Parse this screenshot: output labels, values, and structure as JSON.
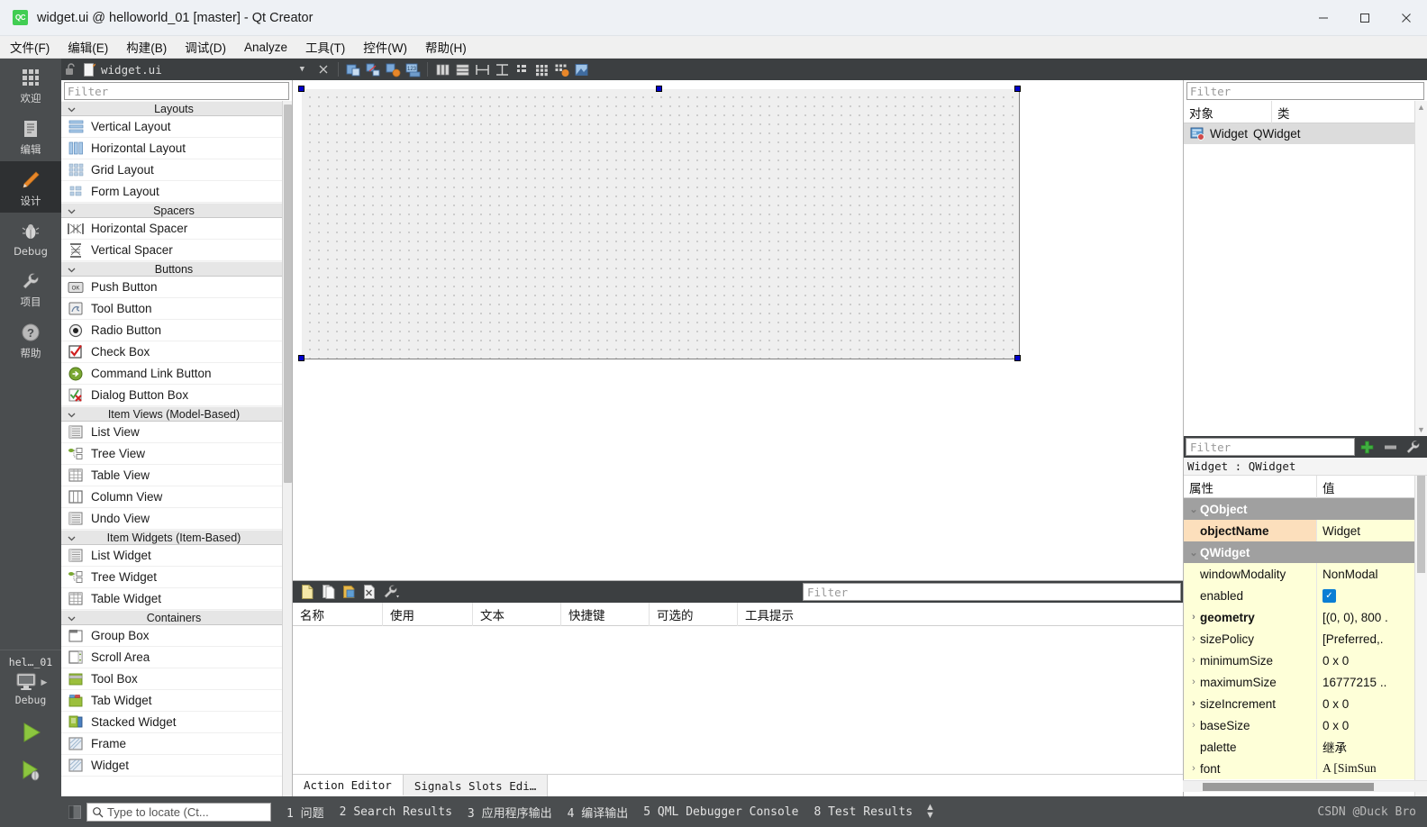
{
  "window": {
    "title": "widget.ui @ helloworld_01 [master] - Qt Creator",
    "logo_text": "QC",
    "controls": {
      "minimize": "minimize-icon",
      "maximize": "maximize-icon",
      "close": "close-icon"
    }
  },
  "menubar": {
    "items": [
      {
        "label": "文件(F)",
        "name": "menu-file"
      },
      {
        "label": "编辑(E)",
        "name": "menu-edit"
      },
      {
        "label": "构建(B)",
        "name": "menu-build"
      },
      {
        "label": "调试(D)",
        "name": "menu-debug"
      },
      {
        "label": "Analyze",
        "name": "menu-analyze"
      },
      {
        "label": "工具(T)",
        "name": "menu-tools"
      },
      {
        "label": "控件(W)",
        "name": "menu-window"
      },
      {
        "label": "帮助(H)",
        "name": "menu-help"
      }
    ]
  },
  "modebar": {
    "items": [
      {
        "label": "欢迎",
        "icon": "grid-icon",
        "active": false
      },
      {
        "label": "编辑",
        "icon": "document-icon",
        "active": false
      },
      {
        "label": "设计",
        "icon": "pencil-icon",
        "active": true
      },
      {
        "label": "Debug",
        "icon": "bug-icon",
        "active": false
      },
      {
        "label": "项目",
        "icon": "wrench-icon",
        "active": false
      },
      {
        "label": "帮助",
        "icon": "question-icon",
        "active": false
      }
    ],
    "kit": {
      "project": "hel…_01",
      "build_config": "Debug",
      "target_icon": "monitor-icon"
    },
    "actions": [
      {
        "name": "run-button",
        "icon": "play-icon"
      },
      {
        "name": "debug-button",
        "icon": "play-bug-icon"
      },
      {
        "name": "build-button",
        "icon": "hammer-icon"
      }
    ]
  },
  "editor_toolbar": {
    "lock_icon": "unlocked-icon",
    "file_icon": "ui-file-icon",
    "file_name": "widget.ui",
    "dropdown_icon": "chevron-down-icon",
    "close_icon": "close-icon",
    "buttons": [
      {
        "name": "edit-widgets-button",
        "icon": "edit-widgets-icon"
      },
      {
        "name": "edit-signals-slots-button",
        "icon": "signals-slots-icon"
      },
      {
        "name": "edit-buddies-button",
        "icon": "buddies-icon"
      },
      {
        "name": "edit-tab-order-button",
        "icon": "tab-order-icon"
      },
      {
        "name": "layout-horizontally-button",
        "icon": "layout-h-icon"
      },
      {
        "name": "layout-vertically-button",
        "icon": "layout-v-icon"
      },
      {
        "name": "layout-splitter-h-button",
        "icon": "splitter-h-icon"
      },
      {
        "name": "layout-splitter-v-button",
        "icon": "splitter-v-icon"
      },
      {
        "name": "layout-form-button",
        "icon": "form-layout-icon"
      },
      {
        "name": "layout-grid-button",
        "icon": "grid-layout-icon"
      },
      {
        "name": "break-layout-button",
        "icon": "break-layout-icon"
      },
      {
        "name": "adjust-size-button",
        "icon": "adjust-size-icon"
      }
    ]
  },
  "widget_box": {
    "filter_placeholder": "Filter",
    "groups": [
      {
        "title": "Layouts",
        "name": "widget-group-layouts",
        "items": [
          {
            "label": "Vertical Layout",
            "icon": "vertical-layout-icon"
          },
          {
            "label": "Horizontal Layout",
            "icon": "horizontal-layout-icon"
          },
          {
            "label": "Grid Layout",
            "icon": "grid-layout-icon"
          },
          {
            "label": "Form Layout",
            "icon": "form-layout-icon"
          }
        ]
      },
      {
        "title": "Spacers",
        "name": "widget-group-spacers",
        "items": [
          {
            "label": "Horizontal Spacer",
            "icon": "horizontal-spacer-icon"
          },
          {
            "label": "Vertical Spacer",
            "icon": "vertical-spacer-icon"
          }
        ]
      },
      {
        "title": "Buttons",
        "name": "widget-group-buttons",
        "items": [
          {
            "label": "Push Button",
            "icon": "push-button-icon"
          },
          {
            "label": "Tool Button",
            "icon": "tool-button-icon"
          },
          {
            "label": "Radio Button",
            "icon": "radio-button-icon"
          },
          {
            "label": "Check Box",
            "icon": "check-box-icon"
          },
          {
            "label": "Command Link Button",
            "icon": "command-link-icon"
          },
          {
            "label": "Dialog Button Box",
            "icon": "dialog-button-box-icon"
          }
        ]
      },
      {
        "title": "Item Views (Model-Based)",
        "name": "widget-group-item-views",
        "items": [
          {
            "label": "List View",
            "icon": "list-view-icon"
          },
          {
            "label": "Tree View",
            "icon": "tree-view-icon"
          },
          {
            "label": "Table View",
            "icon": "table-view-icon"
          },
          {
            "label": "Column View",
            "icon": "column-view-icon"
          },
          {
            "label": "Undo View",
            "icon": "undo-view-icon"
          }
        ]
      },
      {
        "title": "Item Widgets (Item-Based)",
        "name": "widget-group-item-widgets",
        "items": [
          {
            "label": "List Widget",
            "icon": "list-widget-icon"
          },
          {
            "label": "Tree Widget",
            "icon": "tree-widget-icon"
          },
          {
            "label": "Table Widget",
            "icon": "table-widget-icon"
          }
        ]
      },
      {
        "title": "Containers",
        "name": "widget-group-containers",
        "items": [
          {
            "label": "Group Box",
            "icon": "group-box-icon"
          },
          {
            "label": "Scroll Area",
            "icon": "scroll-area-icon"
          },
          {
            "label": "Tool Box",
            "icon": "tool-box-icon"
          },
          {
            "label": "Tab Widget",
            "icon": "tab-widget-icon"
          },
          {
            "label": "Stacked Widget",
            "icon": "stacked-widget-icon"
          },
          {
            "label": "Frame",
            "icon": "frame-icon"
          },
          {
            "label": "Widget",
            "icon": "widget-icon"
          }
        ]
      }
    ]
  },
  "form_canvas": {
    "selection_handles": 4,
    "widget_name": "Widget"
  },
  "action_editor": {
    "toolbar_buttons": [
      {
        "name": "new-action-button",
        "icon": "new-file-icon"
      },
      {
        "name": "copy-action-button",
        "icon": "copy-icon"
      },
      {
        "name": "paste-action-button",
        "icon": "paste-icon"
      },
      {
        "name": "delete-action-button",
        "icon": "delete-icon"
      },
      {
        "name": "action-settings-button",
        "icon": "wrench-icon"
      }
    ],
    "filter_placeholder": "Filter",
    "columns": [
      "名称",
      "使用",
      "文本",
      "快捷键",
      "可选的",
      "工具提示"
    ],
    "rows": [],
    "tabs": [
      {
        "label": "Action Editor",
        "active": true
      },
      {
        "label": "Signals  Slots Edi…",
        "active": false
      }
    ]
  },
  "object_inspector": {
    "filter_placeholder": "Filter",
    "columns": [
      "对象",
      "类"
    ],
    "rows": [
      {
        "object": "Widget",
        "class": "QWidget",
        "icon": "qwidget-icon",
        "selected": true
      }
    ]
  },
  "property_editor": {
    "filter_placeholder": "Filter",
    "toolbar_buttons": [
      {
        "name": "add-dynamic-property-button",
        "icon": "plus-icon"
      },
      {
        "name": "remove-dynamic-property-button",
        "icon": "minus-icon"
      },
      {
        "name": "property-settings-button",
        "icon": "wrench-icon"
      }
    ],
    "object_line": "Widget : QWidget",
    "columns": [
      "属性",
      "值"
    ],
    "rows": [
      {
        "kind": "group",
        "name": "QObject",
        "value": ""
      },
      {
        "kind": "prop",
        "name": "objectName",
        "value": "Widget",
        "accent": true,
        "bold": true,
        "expandable": false
      },
      {
        "kind": "group",
        "name": "QWidget",
        "value": ""
      },
      {
        "kind": "prop",
        "name": "windowModality",
        "value": "NonModal",
        "accent": false,
        "bold": false,
        "expandable": false
      },
      {
        "kind": "prop",
        "name": "enabled",
        "value": "checked",
        "accent": false,
        "bold": false,
        "expandable": false
      },
      {
        "kind": "prop",
        "name": "geometry",
        "value": "[(0, 0), 800 .",
        "accent": false,
        "bold": true,
        "expandable": true
      },
      {
        "kind": "prop",
        "name": "sizePolicy",
        "value": "[Preferred,.",
        "accent": false,
        "bold": false,
        "expandable": true
      },
      {
        "kind": "prop",
        "name": "minimumSize",
        "value": "0 x 0",
        "accent": false,
        "bold": false,
        "expandable": true
      },
      {
        "kind": "prop",
        "name": "maximumSize",
        "value": "16777215 ..",
        "accent": false,
        "bold": false,
        "expandable": true
      },
      {
        "kind": "prop",
        "name": "sizeIncrement",
        "value": "0 x 0",
        "accent": false,
        "bold": false,
        "expandable": true
      },
      {
        "kind": "prop",
        "name": "baseSize",
        "value": "0 x 0",
        "accent": false,
        "bold": false,
        "expandable": true
      },
      {
        "kind": "prop",
        "name": "palette",
        "value": "继承",
        "accent": false,
        "bold": false,
        "expandable": false
      },
      {
        "kind": "prop",
        "name": "font",
        "value": "A  [SimSun",
        "accent": false,
        "bold": false,
        "expandable": true
      }
    ]
  },
  "statusbar": {
    "locate_placeholder": "Type to locate (Ct...",
    "search_icon": "search-icon",
    "sidebar_toggle_icon": "sidebar-toggle-icon",
    "output_panes": [
      {
        "num": "1",
        "label": "问题",
        "cjk": true
      },
      {
        "num": "2",
        "label": "Search Results",
        "cjk": false
      },
      {
        "num": "3",
        "label": "应用程序输出",
        "cjk": true
      },
      {
        "num": "4",
        "label": "编译输出",
        "cjk": true
      },
      {
        "num": "5",
        "label": "QML Debugger Console",
        "cjk": false
      },
      {
        "num": "8",
        "label": "Test Results",
        "cjk": false
      }
    ],
    "watermark": "CSDN @Duck Bro"
  },
  "colors": {
    "accent_green": "#41cd52",
    "dark_chrome": "#3c3f41",
    "mode_bar": "#4a4d4f",
    "selection_handle": "#0000cc",
    "property_yellow": "#feffd8",
    "property_accent": "#fcdfbc"
  }
}
